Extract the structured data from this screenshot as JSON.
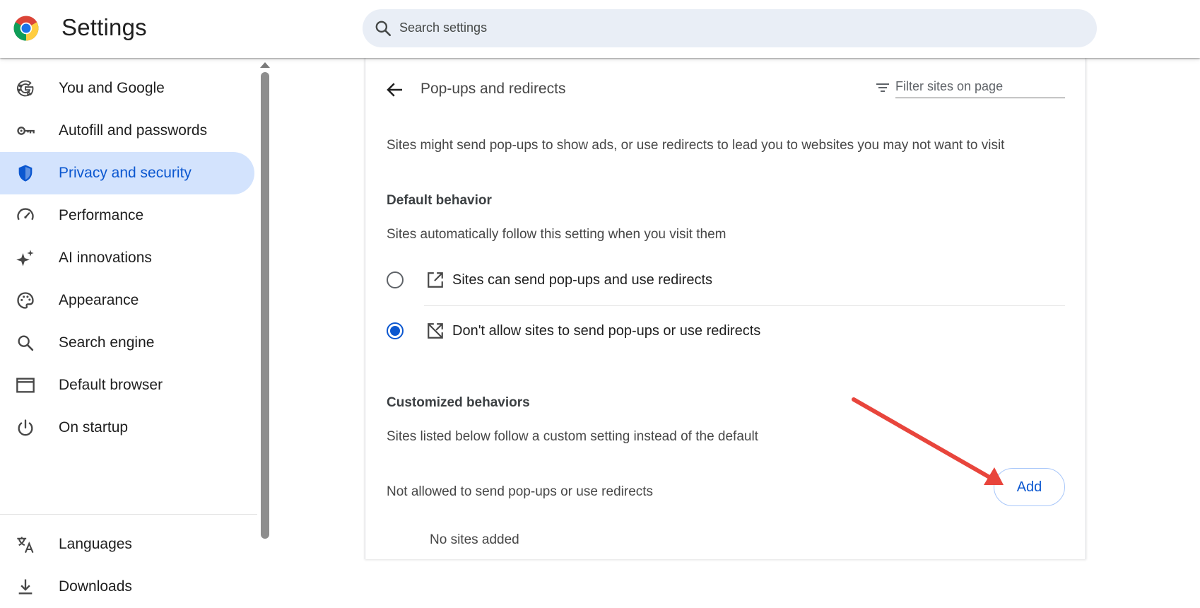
{
  "header": {
    "app_title": "Settings",
    "logo_icon": "chrome-logo-icon",
    "search_placeholder": "Search settings"
  },
  "sidebar": {
    "items": [
      {
        "label": "You and Google",
        "icon": "google-g-icon",
        "active": false
      },
      {
        "label": "Autofill and passwords",
        "icon": "key-icon",
        "active": false
      },
      {
        "label": "Privacy and security",
        "icon": "shield-icon",
        "active": true
      },
      {
        "label": "Performance",
        "icon": "speedometer-icon",
        "active": false
      },
      {
        "label": "AI innovations",
        "icon": "sparkle-icon",
        "active": false
      },
      {
        "label": "Appearance",
        "icon": "palette-icon",
        "active": false
      },
      {
        "label": "Search engine",
        "icon": "search-icon",
        "active": false
      },
      {
        "label": "Default browser",
        "icon": "browser-window-icon",
        "active": false
      },
      {
        "label": "On startup",
        "icon": "power-icon",
        "active": false
      },
      {
        "label": "Languages",
        "icon": "translate-icon",
        "active": false
      },
      {
        "label": "Downloads",
        "icon": "download-icon",
        "active": false
      }
    ]
  },
  "main": {
    "title": "Pop-ups and redirects",
    "filter_placeholder": "Filter sites on page",
    "description": "Sites might send pop-ups to show ads, or use redirects to lead you to websites you may not want to visit",
    "default_behavior": {
      "heading": "Default behavior",
      "subtext": "Sites automatically follow this setting when you visit them",
      "options": [
        {
          "label": "Sites can send pop-ups and use redirects",
          "icon": "open-in-new-icon",
          "checked": false
        },
        {
          "label": "Don't allow sites to send pop-ups or use redirects",
          "icon": "open-in-new-off-icon",
          "checked": true
        }
      ]
    },
    "customized_behaviors": {
      "heading": "Customized behaviors",
      "subtext": "Sites listed below follow a custom setting instead of the default",
      "not_allowed_label": "Not allowed to send pop-ups or use redirects",
      "add_label": "Add",
      "empty_label": "No sites added"
    }
  },
  "colors": {
    "accent": "#0b57d0",
    "active_bg": "#d3e3fd",
    "search_bg": "#e9eef6",
    "annotation_arrow": "#e8453c"
  }
}
